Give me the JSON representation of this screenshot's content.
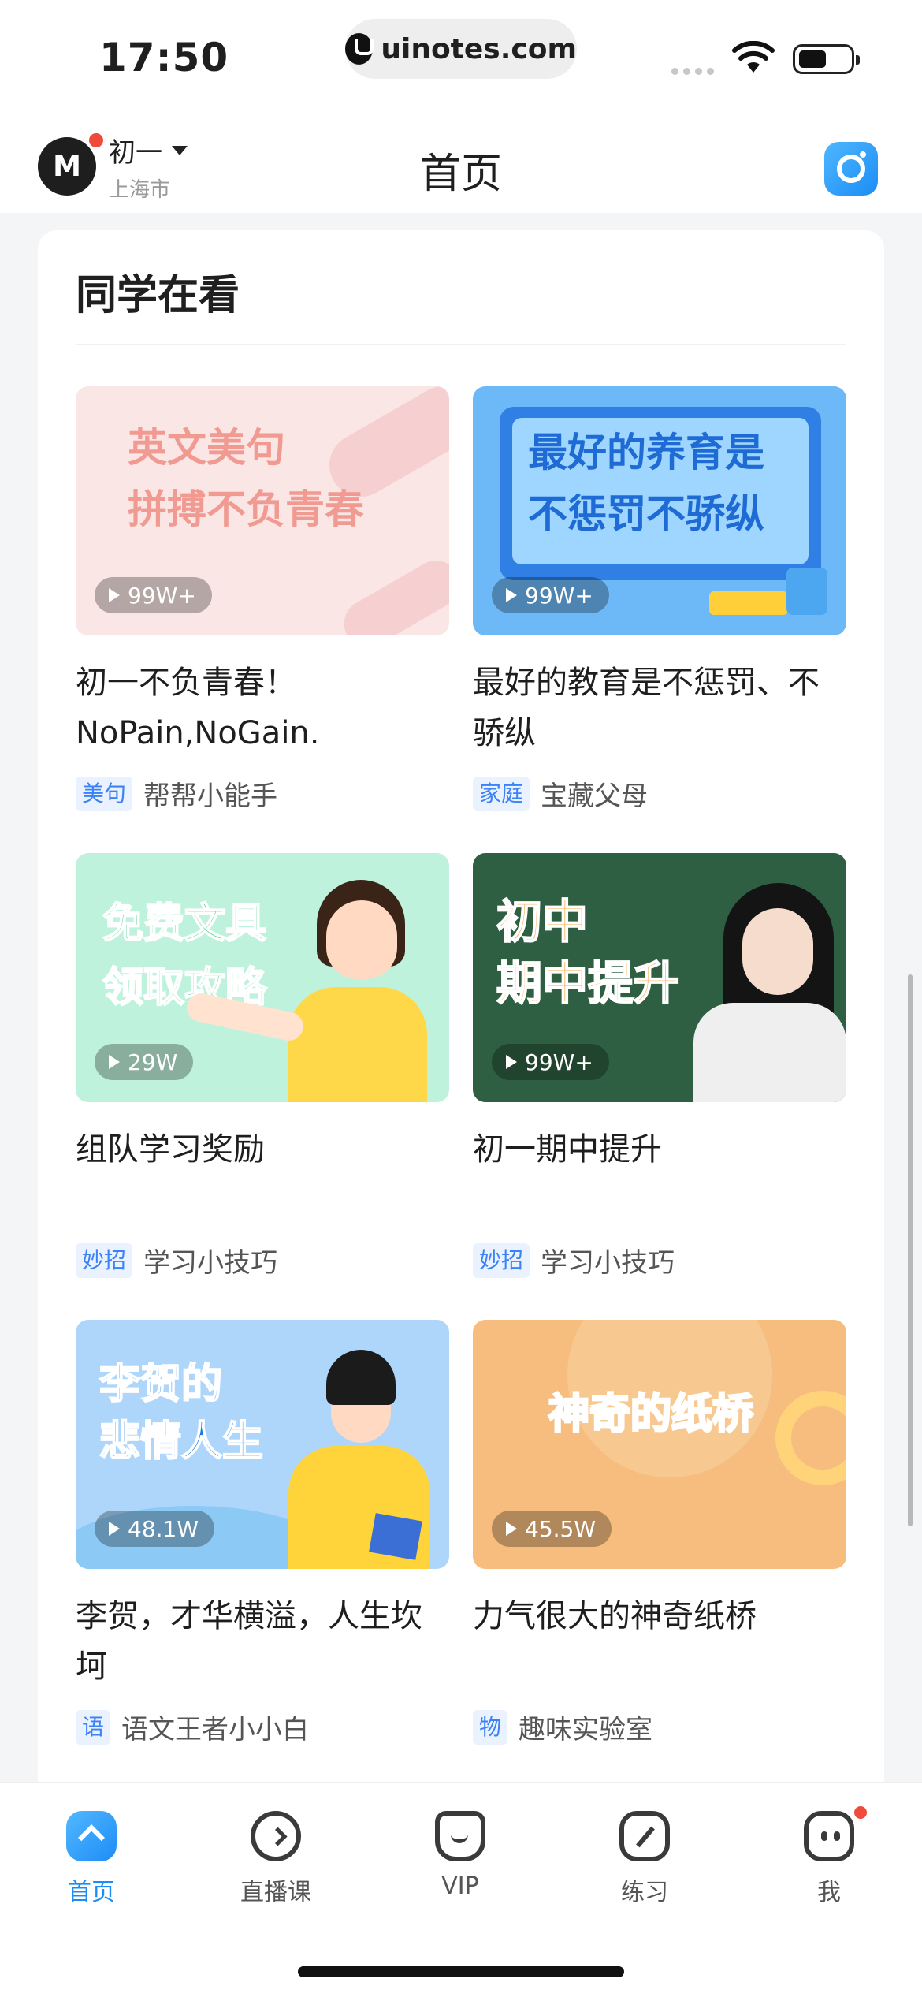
{
  "status_bar": {
    "time": "17:50",
    "url": "uinotes.com"
  },
  "header": {
    "grade": "初一",
    "city": "上海市",
    "title": "首页",
    "logo_text": "M"
  },
  "section": {
    "title": "同学在看",
    "items": [
      {
        "thumb_lines": [
          "英文美句",
          "拼搏不负青春"
        ],
        "views": "99W+",
        "title": "初一不负青春！NoPain,NoGain.",
        "tag": "美句",
        "author": "帮帮小能手"
      },
      {
        "thumb_lines": [
          "最好的养育是",
          "不惩罚不骄纵"
        ],
        "views": "99W+",
        "title": "最好的教育是不惩罚、不骄纵",
        "tag": "家庭",
        "author": "宝藏父母"
      },
      {
        "thumb_lines": [
          "免费文具",
          "领取攻略"
        ],
        "views": "29W",
        "title": "组队学习奖励",
        "tag": "妙招",
        "author": "学习小技巧"
      },
      {
        "thumb_lines": [
          "初中",
          "期中提升"
        ],
        "views": "99W+",
        "title": "初一期中提升",
        "tag": "妙招",
        "author": "学习小技巧"
      },
      {
        "thumb_lines": [
          "李贺的",
          "悲情人生"
        ],
        "views": "48.1W",
        "title": "李贺，才华横溢，人生坎坷",
        "tag": "语",
        "author": "语文王者小小白"
      },
      {
        "thumb_lines": [
          "神奇的纸桥"
        ],
        "views": "45.5W",
        "title": "力气很大的神奇纸桥",
        "tag": "物",
        "author": "趣味实验室"
      }
    ]
  },
  "tabbar": {
    "tabs": [
      {
        "label": "首页",
        "icon": "home-icon"
      },
      {
        "label": "直播课",
        "icon": "live-icon"
      },
      {
        "label": "VIP",
        "icon": "vip-icon"
      },
      {
        "label": "练习",
        "icon": "practice-icon"
      },
      {
        "label": "我",
        "icon": "me-icon"
      }
    ]
  },
  "colors": {
    "accent": "#1d8cf6",
    "badge": "#f04a3a",
    "tag_text": "#3b82f6"
  }
}
